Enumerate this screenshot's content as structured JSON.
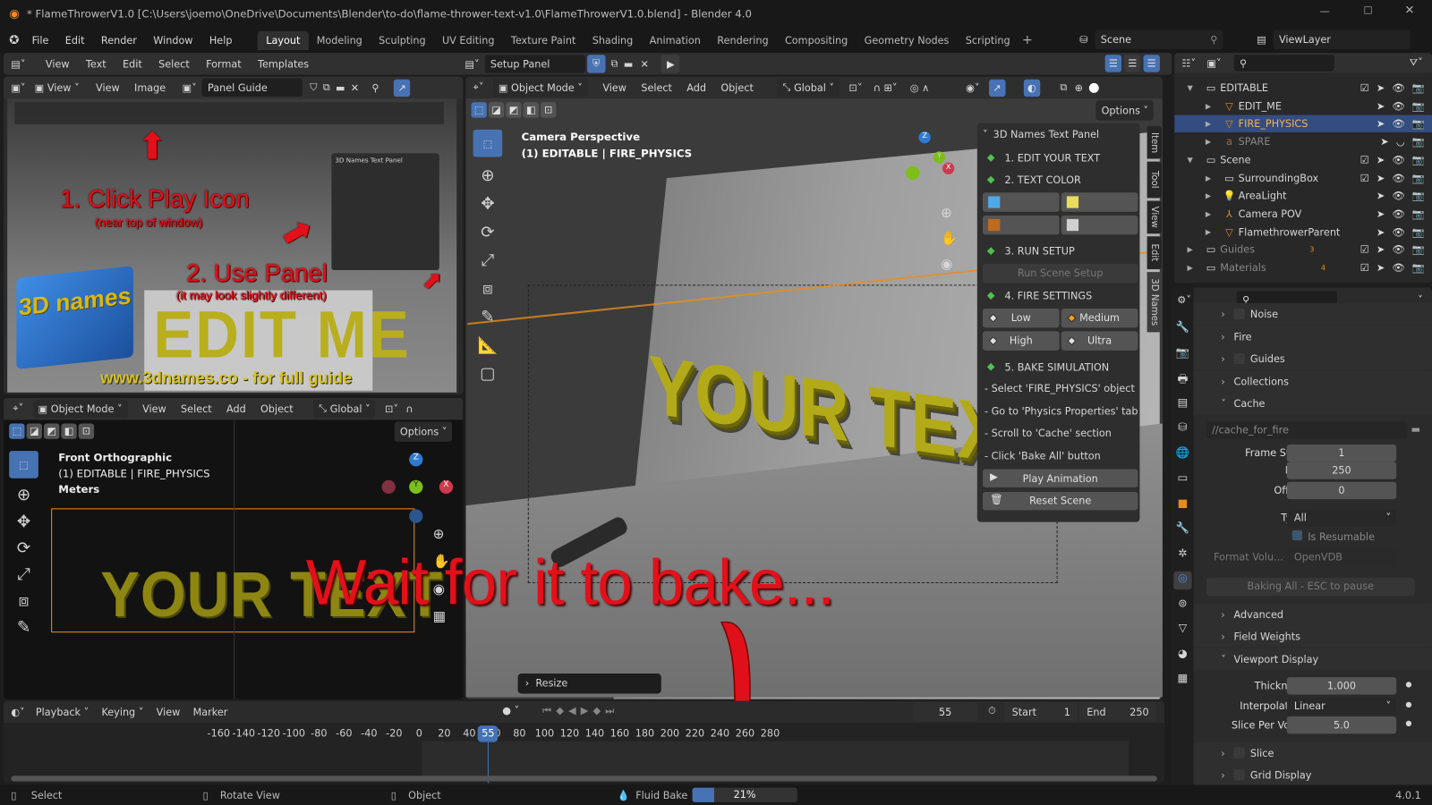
{
  "window": {
    "title": "* FlameThrowerV1.0 [C:\\Users\\joemo\\OneDrive\\Documents\\Blender\\to-do\\flame-thrower-text-v1.0\\FlameThrowerV1.0.blend] - Blender 4.0",
    "version": "4.0.1"
  },
  "menubar": {
    "items": [
      "File",
      "Edit",
      "Render",
      "Window",
      "Help"
    ],
    "workspaces": [
      "Layout",
      "Modeling",
      "Sculpting",
      "UV Editing",
      "Texture Paint",
      "Shading",
      "Animation",
      "Rendering",
      "Compositing",
      "Geometry Nodes",
      "Scripting"
    ],
    "active_workspace": "Layout",
    "add": "+",
    "scene": "Scene",
    "view_layer": "ViewLayer"
  },
  "text_editor": {
    "menu": [
      "View",
      "Text",
      "Edit",
      "Select",
      "Format",
      "Templates"
    ],
    "text_name": "Setup Panel"
  },
  "image_editor": {
    "menu_view_dropdown": "View",
    "menu": [
      "View",
      "Image"
    ],
    "image_name": "Panel Guide",
    "guide": {
      "step1": "1. Click Play Icon",
      "step1_sub": "(near top of window)",
      "step2": "2. Use Panel",
      "step2_sub": "(it may look slightly different)",
      "watermark": "EDIT ME",
      "logo_text": "3D names",
      "url": "www.3dnames.co - for full guide"
    }
  },
  "front_viewport": {
    "mode": "Object Mode",
    "menu": [
      "View",
      "Select",
      "Add",
      "Object"
    ],
    "orientation": "Global",
    "options": "Options",
    "info": [
      "Front Orthographic",
      "(1) EDITABLE | FIRE_PHYSICS",
      "Meters"
    ],
    "scene_text": "YOUR TEXT"
  },
  "main_viewport": {
    "mode": "Object Mode",
    "menu": [
      "View",
      "Select",
      "Add",
      "Object"
    ],
    "orientation": "Global",
    "options": "Options",
    "info": [
      "Camera Perspective",
      "(1) EDITABLE | FIRE_PHYSICS"
    ],
    "scene_text": "YOUR TEXT",
    "operator_panel": "Resize",
    "side_tabs": [
      "Item",
      "Tool",
      "View",
      "Edit",
      "3D Names"
    ]
  },
  "npanel": {
    "title": "3D Names Text Panel",
    "sections": [
      "1. EDIT YOUR TEXT",
      "2. TEXT COLOR",
      "3. RUN SETUP",
      "4. FIRE SETTINGS",
      "5. BAKE SIMULATION"
    ],
    "colors": [
      {
        "label": "Blue",
        "swatch": "#4fa9e6"
      },
      {
        "label": "Yellow",
        "swatch": "#e8dc5a"
      },
      {
        "label": "Gold",
        "swatch": "#c06a1c"
      },
      {
        "label": "Silver",
        "swatch": "#d0d0d0"
      }
    ],
    "run_setup": "Run Scene Setup",
    "fire": [
      {
        "label": "Low",
        "active": false
      },
      {
        "label": "Medium",
        "active": true
      },
      {
        "label": "High",
        "active": false
      },
      {
        "label": "Ultra",
        "active": false
      }
    ],
    "bake_steps": [
      "- Select 'FIRE_PHYSICS' object",
      "- Go to 'Physics Properties' tab",
      "- Scroll to 'Cache' section",
      "- Click 'Bake All' button"
    ],
    "play": "Play Animation",
    "reset": "Reset Scene"
  },
  "overlay": {
    "message": "Wait for it to bake..."
  },
  "outliner": {
    "rows": [
      {
        "name": "EDITABLE",
        "type": "collection",
        "depth": 0,
        "expanded": true
      },
      {
        "name": "EDIT_ME",
        "type": "mesh",
        "depth": 1
      },
      {
        "name": "FIRE_PHYSICS",
        "type": "mesh",
        "depth": 1,
        "selected": true
      },
      {
        "name": "SPARE",
        "type": "text",
        "depth": 1,
        "hidden": true
      },
      {
        "name": "Scene",
        "type": "collection",
        "depth": 0,
        "expanded": true
      },
      {
        "name": "SurroundingBox",
        "type": "collection",
        "depth": 1
      },
      {
        "name": "AreaLight",
        "type": "light",
        "depth": 1
      },
      {
        "name": "Camera POV",
        "type": "empty",
        "depth": 1
      },
      {
        "name": "FlamethrowerParent",
        "type": "mesh",
        "depth": 1
      },
      {
        "name": "Guides",
        "type": "collection",
        "depth": 0,
        "badge": "3"
      },
      {
        "name": "Materials",
        "type": "collection",
        "depth": 0,
        "badge": "4"
      }
    ]
  },
  "properties": {
    "panels_top": [
      "Noise",
      "Fire",
      "Guides",
      "Collections"
    ],
    "cache": {
      "title": "Cache",
      "path": "//cache_for_fire",
      "frame_start_label": "Frame Start",
      "frame_start": "1",
      "end_label": "End",
      "end": "250",
      "offset_label": "Offset",
      "offset": "0",
      "type_label": "Type",
      "type": "All",
      "resumable": "Is Resumable",
      "format_label": "Format Volu...",
      "format": "OpenVDB",
      "bake_btn": "Baking All - ESC to pause"
    },
    "panels_mid": [
      "Advanced",
      "Field Weights"
    ],
    "viewport_display": {
      "title": "Viewport Display",
      "thickness_label": "Thickness",
      "thickness": "1.000",
      "interp_label": "Interpolation",
      "interp": "Linear",
      "slice_label": "Slice Per Voxel",
      "slice": "5.0"
    },
    "panels_bottom": [
      "Slice",
      "Grid Display"
    ]
  },
  "timeline": {
    "menu": [
      "Playback",
      "Keying",
      "View",
      "Marker"
    ],
    "current_frame": "55",
    "start_label": "Start",
    "start": "1",
    "end_label": "End",
    "end": "250",
    "ticks": [
      "-160",
      "-140",
      "-120",
      "-100",
      "-80",
      "-60",
      "-40",
      "-20",
      "0",
      "20",
      "40",
      "60",
      "80",
      "100",
      "120",
      "140",
      "160",
      "180",
      "200",
      "220",
      "240",
      "260",
      "280"
    ]
  },
  "statusbar": {
    "select": "Select",
    "rotate": "Rotate View",
    "object": "Object",
    "job": "Fluid Bake",
    "progress_label": "21%",
    "progress": 0.21
  },
  "colors": {
    "accent": "#4772b3",
    "selected_row": "#334d80",
    "active_text": "#f5b352",
    "red_annotation": "#e3101a"
  }
}
